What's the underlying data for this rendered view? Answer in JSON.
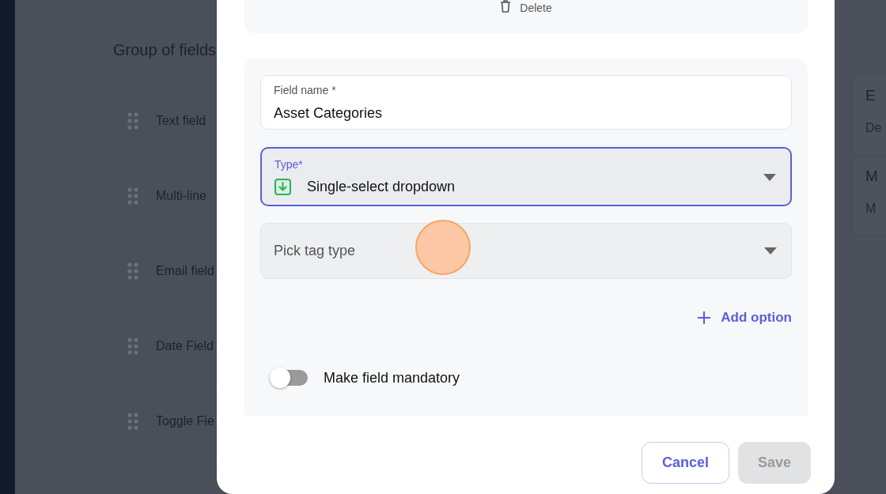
{
  "background_page": {
    "group_title": "Group of fields",
    "fields": [
      {
        "label": "Text field"
      },
      {
        "label": "Multi-line"
      },
      {
        "label": "Email field"
      },
      {
        "label": "Date Field"
      },
      {
        "label": "Toggle Fie"
      }
    ],
    "side_cards": [
      {
        "title": "E",
        "subtitle": "De"
      },
      {
        "title": "M",
        "subtitle": "M"
      }
    ]
  },
  "modal": {
    "delete_label": "Delete",
    "field_name": {
      "label": "Field name *",
      "value": "Asset Categories"
    },
    "type_select": {
      "label": "Type*",
      "value": "Single-select dropdown",
      "focused": true
    },
    "tag_select": {
      "placeholder": "Pick tag type"
    },
    "add_option": "Add option",
    "mandatory_toggle": {
      "label": "Make field mandatory",
      "on": false
    },
    "buttons": [
      {
        "label": "Cancel",
        "kind": "secondary",
        "disabled": false
      },
      {
        "label": "Save",
        "kind": "primary",
        "disabled": true
      }
    ]
  }
}
